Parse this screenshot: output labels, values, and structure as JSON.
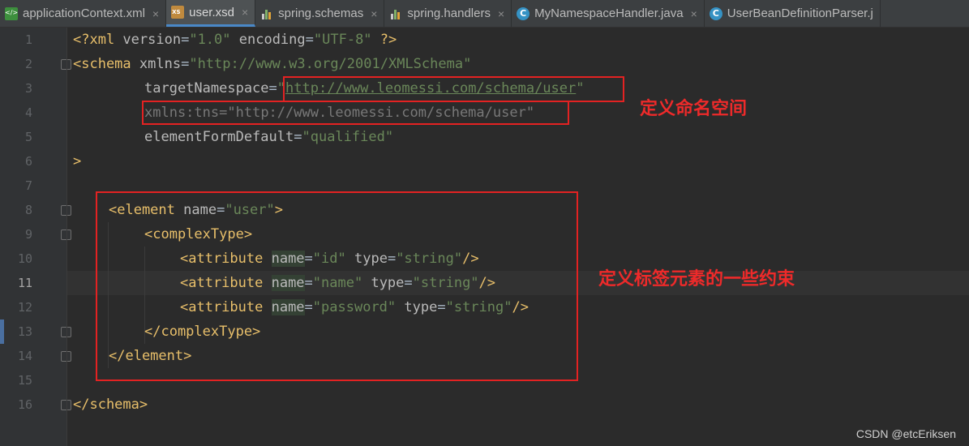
{
  "tabs": [
    {
      "label": "applicationContext.xml",
      "icon": "xml-file-icon",
      "active": false
    },
    {
      "label": "user.xsd",
      "icon": "xsd-file-icon",
      "active": true
    },
    {
      "label": "spring.schemas",
      "icon": "properties-file-icon",
      "active": false
    },
    {
      "label": "spring.handlers",
      "icon": "properties-file-icon",
      "active": false
    },
    {
      "label": "MyNamespaceHandler.java",
      "icon": "java-class-icon",
      "active": false
    },
    {
      "label": "UserBeanDefinitionParser.j",
      "icon": "java-class-icon",
      "active": false
    }
  ],
  "close_glyph": "×",
  "line_numbers": [
    "1",
    "2",
    "3",
    "4",
    "5",
    "6",
    "7",
    "8",
    "9",
    "10",
    "11",
    "12",
    "13",
    "14",
    "15",
    "16"
  ],
  "code": {
    "l1": {
      "a": "<?xml ",
      "b": "version",
      "c": "=",
      "d": "\"1.0\"",
      "e": " encoding",
      "f": "=",
      "g": "\"UTF-8\"",
      "h": " ?>"
    },
    "l2": {
      "a": "<schema ",
      "b": "xmlns",
      "c": "=",
      "d": "\"http://www.w3.org/2001/XMLSchema\""
    },
    "l3": {
      "a": "targetNamespace",
      "b": "=",
      "c": "\"",
      "d": "http://www.leomessi.com/schema/user",
      "e": "\""
    },
    "l4": {
      "a": "xmlns:tns",
      "b": "=",
      "c": "\"http://www.leomessi.com/schema/user\""
    },
    "l5": {
      "a": "elementFormDefault",
      "b": "=",
      "c": "\"qualified\""
    },
    "l6": {
      "a": ">"
    },
    "l8": {
      "a": "<element ",
      "b": "name",
      "c": "=",
      "d": "\"user\"",
      "e": ">"
    },
    "l9": {
      "a": "<complexType>"
    },
    "l10": {
      "a": "<attribute ",
      "b": "name",
      "c": "=",
      "d": "\"id\"",
      "e": " type",
      "f": "=",
      "g": "\"string\"",
      "h": "/>"
    },
    "l11": {
      "a": "<attribute ",
      "b": "name",
      "c": "=",
      "d": "\"name\"",
      "e": " type",
      "f": "=",
      "g": "\"string\"",
      "h": "/>"
    },
    "l12": {
      "a": "<attribute ",
      "b": "name",
      "c": "=",
      "d": "\"password\"",
      "e": " type",
      "f": "=",
      "g": "\"string\"",
      "h": "/>"
    },
    "l13": {
      "a": "</complexType>"
    },
    "l14": {
      "a": "</element>"
    },
    "l16": {
      "a": "</schema>"
    }
  },
  "annotations": {
    "namespace": "定义命名空间",
    "constraints": "定义标签元素的一些约束"
  },
  "watermark": "CSDN @etcEriksen",
  "current_line": "11",
  "colors": {
    "annotation": "#ee2a2a",
    "tag": "#e8bf6a",
    "string": "#6a8759",
    "background": "#2b2b2b"
  }
}
